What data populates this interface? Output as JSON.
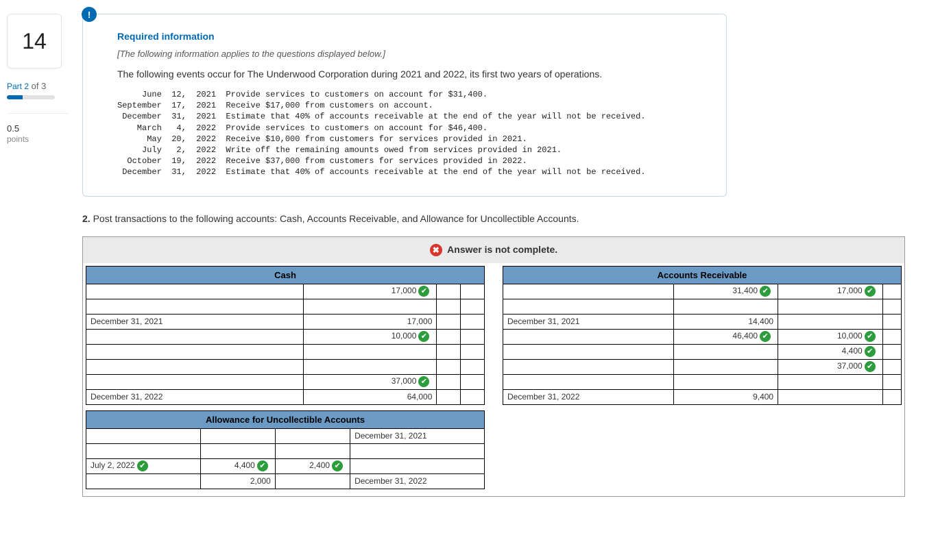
{
  "question_number": "14",
  "part_label": "Part 2",
  "part_of": "of 3",
  "points_value": "0.5",
  "points_label": "points",
  "alert_badge": "!",
  "req_title": "Required information",
  "applies": "[The following information applies to the questions displayed below.]",
  "intro": "The following events occur for The Underwood Corporation during 2021 and 2022, its first two years of operations.",
  "events": "     June  12,  2021  Provide services to customers on account for $31,400.\nSeptember  17,  2021  Receive $17,000 from customers on account.\n December  31,  2021  Estimate that 40% of accounts receivable at the end of the year will not be received.\n    March   4,  2022  Provide services to customers on account for $46,400.\n      May  20,  2022  Receive $10,000 from customers for services provided in 2021.\n     July   2,  2022  Write off the remaining amounts owed from services provided in 2021.\n  October  19,  2022  Receive $37,000 from customers for services provided in 2022.\n December  31,  2022  Estimate that 40% of accounts receivable at the end of the year will not be received.",
  "q2_num": "2.",
  "q2_text": " Post transactions to the following accounts: Cash, Accounts Receivable, and Allowance for Uncollectible Accounts.",
  "banner": "Answer is not complete.",
  "cash": {
    "title": "Cash",
    "rows": [
      {
        "label": "",
        "debit": "17,000",
        "dcheck": true,
        "credit": "",
        "ccheck": false,
        "rlab": ""
      },
      {
        "sep": true
      },
      {
        "label": "December 31, 2021",
        "debit": "17,000",
        "dcheck": false,
        "credit": "",
        "ccheck": false,
        "rlab": ""
      },
      {
        "label": "",
        "debit": "10,000",
        "dcheck": true,
        "credit": "",
        "ccheck": false,
        "rlab": ""
      },
      {
        "blank": true
      },
      {
        "blank": true
      },
      {
        "label": "",
        "debit": "37,000",
        "dcheck": true,
        "credit": "",
        "ccheck": false,
        "rlab": ""
      },
      {
        "label": "December 31, 2022",
        "debit": "64,000",
        "dcheck": false,
        "credit": "",
        "ccheck": false,
        "rlab": ""
      }
    ]
  },
  "ar": {
    "title": "Accounts Receivable",
    "rows": [
      {
        "label": "",
        "debit": "31,400",
        "dcheck": true,
        "credit": "17,000",
        "ccheck": true,
        "rlab": ""
      },
      {
        "sep": true
      },
      {
        "label": "December 31, 2021",
        "debit": "14,400",
        "dcheck": false,
        "credit": "",
        "ccheck": false,
        "rlab": ""
      },
      {
        "label": "",
        "debit": "46,400",
        "dcheck": true,
        "credit": "10,000",
        "ccheck": true,
        "rlab": ""
      },
      {
        "label": "",
        "debit": "",
        "dcheck": false,
        "credit": "4,400",
        "ccheck": true,
        "rlab": ""
      },
      {
        "label": "",
        "debit": "",
        "dcheck": false,
        "credit": "37,000",
        "ccheck": true,
        "rlab": ""
      },
      {
        "blank": true
      },
      {
        "label": "December 31, 2022",
        "debit": "9,400",
        "dcheck": false,
        "credit": "",
        "ccheck": false,
        "rlab": ""
      }
    ]
  },
  "allow": {
    "title": "Allowance for Uncollectible Accounts",
    "rows": [
      {
        "label": "",
        "lcheck": false,
        "debit": "",
        "dcheck": false,
        "credit": "",
        "ccheck": false,
        "rlab": "December 31, 2021"
      },
      {
        "blank": true
      },
      {
        "label": "July 2, 2022",
        "lcheck": true,
        "debit": "4,400",
        "dcheck": true,
        "credit": "2,400",
        "ccheck": true,
        "rlab": ""
      },
      {
        "label": "",
        "lcheck": false,
        "debit": "2,000",
        "dcheck": false,
        "credit": "",
        "ccheck": false,
        "rlab": "December 31, 2022"
      }
    ]
  }
}
